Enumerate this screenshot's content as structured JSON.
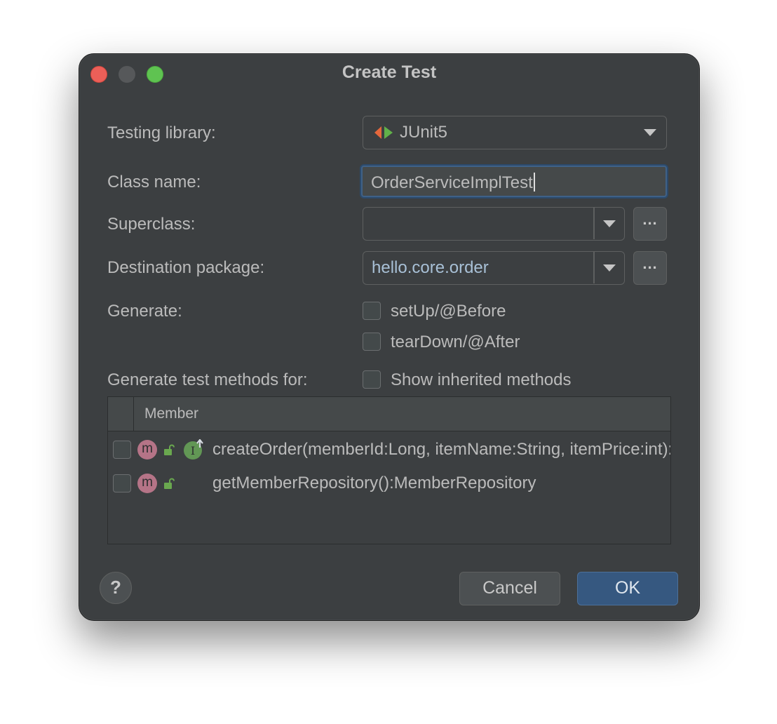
{
  "window": {
    "title": "Create Test"
  },
  "form": {
    "testing_library": {
      "label": "Testing library:",
      "value": "JUnit5",
      "icon": "junit-icon"
    },
    "class_name": {
      "label": "Class name:",
      "value": "OrderServiceImplTest"
    },
    "superclass": {
      "label": "Superclass:",
      "value": "",
      "browse_label": "..."
    },
    "destination_package": {
      "label": "Destination package:",
      "value": "hello.core.order",
      "browse_label": "..."
    },
    "generate": {
      "label": "Generate:",
      "options": [
        {
          "label": "setUp/@Before",
          "checked": false
        },
        {
          "label": "tearDown/@After",
          "checked": false
        }
      ]
    },
    "methods_for": {
      "label": "Generate test methods for:",
      "show_inherited": {
        "label": "Show inherited methods",
        "checked": false
      }
    }
  },
  "members_table": {
    "header": "Member",
    "rows": [
      {
        "checked": false,
        "badge": "m",
        "text": "createOrder(memberId:Long, itemName:String, itemPrice:int):Order",
        "implements_icon": true
      },
      {
        "checked": false,
        "badge": "m",
        "text": "getMemberRepository():MemberRepository",
        "implements_icon": false
      }
    ]
  },
  "footer": {
    "help_label": "?",
    "cancel_label": "Cancel",
    "ok_label": "OK"
  },
  "colors": {
    "dialog_bg": "#3c3f41",
    "ok_button": "#365880",
    "focus_border": "#3f6187",
    "method_badge": "#b57487",
    "implements_badge": "#629755"
  }
}
